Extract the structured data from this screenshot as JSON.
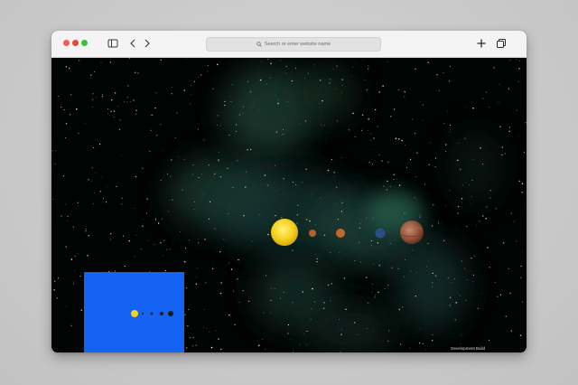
{
  "browser": {
    "address_placeholder": "Search or enter website name",
    "icons": [
      "sidebar-icon",
      "back-icon",
      "forward-icon",
      "search-icon",
      "new-tab-icon",
      "tabs-overview-icon"
    ]
  },
  "scene": {
    "background_color": "#020403",
    "planets": [
      "sun",
      "planet-1",
      "planet-2",
      "planet-3",
      "planet-4"
    ],
    "minimap_color": "#1463f2"
  },
  "footer": {
    "build_label": "Development Build"
  }
}
